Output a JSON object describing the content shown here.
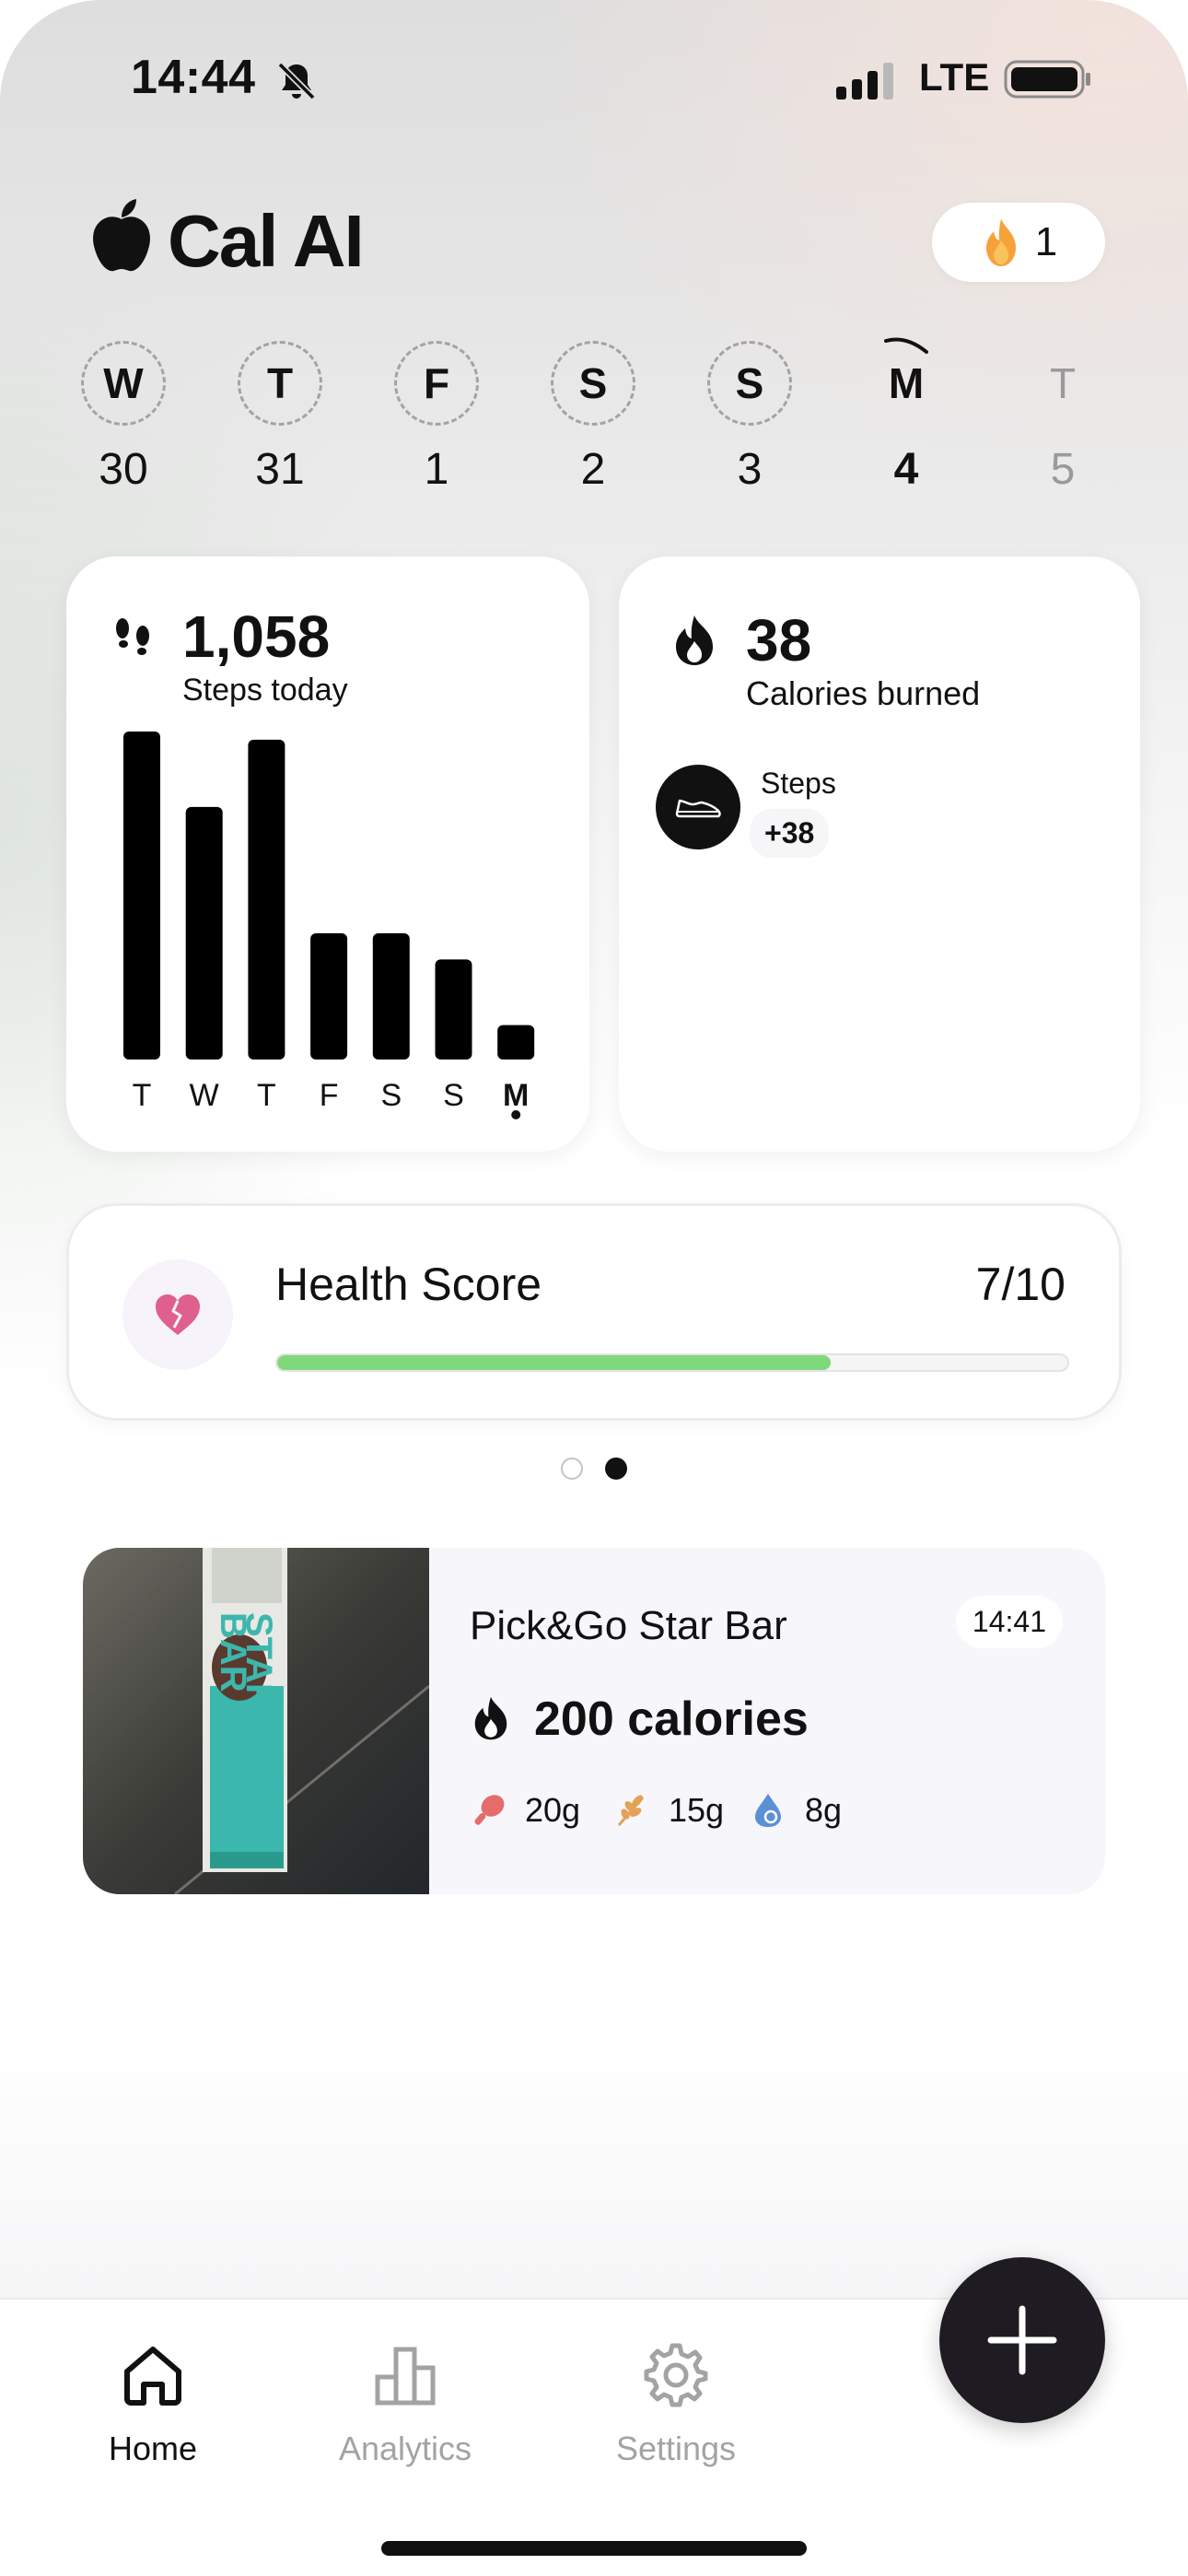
{
  "status_bar": {
    "time": "14:44",
    "network": "LTE",
    "icons": [
      "bell-slash-icon",
      "signal-bars-icon",
      "battery-icon"
    ]
  },
  "header": {
    "app_name": "Cal AI",
    "logo_icon": "apple-icon",
    "streak": {
      "icon": "flame-icon",
      "count": "1"
    }
  },
  "week": [
    {
      "letter": "W",
      "date": "30",
      "state": "past"
    },
    {
      "letter": "T",
      "date": "31",
      "state": "past"
    },
    {
      "letter": "F",
      "date": "1",
      "state": "past"
    },
    {
      "letter": "S",
      "date": "2",
      "state": "past"
    },
    {
      "letter": "S",
      "date": "3",
      "state": "past"
    },
    {
      "letter": "M",
      "date": "4",
      "state": "today"
    },
    {
      "letter": "T",
      "date": "5",
      "state": "future"
    }
  ],
  "steps_card": {
    "icon": "footsteps-icon",
    "value": "1,058",
    "label": "Steps today"
  },
  "chart_data": {
    "type": "bar",
    "categories": [
      "T",
      "W",
      "T",
      "F",
      "S",
      "S",
      "M"
    ],
    "values": [
      1.0,
      0.77,
      0.975,
      0.385,
      0.385,
      0.305,
      0.105
    ],
    "highlight_index": 6,
    "bar_color": "#000000",
    "title": "",
    "xlabel": "",
    "ylabel": ""
  },
  "calories_card": {
    "icon": "flame-outline-icon",
    "value": "38",
    "label": "Calories burned",
    "sources": [
      {
        "icon": "shoe-icon",
        "label": "Steps",
        "value": "+38"
      }
    ]
  },
  "health_score": {
    "icon": "broken-heart-icon",
    "title": "Health Score",
    "value": "7/10",
    "progress": 0.7,
    "bar_color": "#7fd97a"
  },
  "pager": {
    "count": 2,
    "active_index": 1
  },
  "food_log": [
    {
      "name": "Pick&Go Star Bar",
      "time": "14:41",
      "calories": "200 calories",
      "macros": [
        {
          "icon": "protein-drumstick-icon",
          "value": "20g",
          "color": "#e66b6b"
        },
        {
          "icon": "carbs-wheat-icon",
          "value": "15g",
          "color": "#e3a257"
        },
        {
          "icon": "fat-drop-icon",
          "value": "8g",
          "color": "#5b8fd6"
        }
      ]
    }
  ],
  "nav": {
    "items": [
      {
        "label": "Home",
        "icon": "home-icon",
        "active": true
      },
      {
        "label": "Analytics",
        "icon": "bar-chart-icon",
        "active": false
      },
      {
        "label": "Settings",
        "icon": "gear-icon",
        "active": false
      }
    ],
    "fab_icon": "plus-icon"
  }
}
